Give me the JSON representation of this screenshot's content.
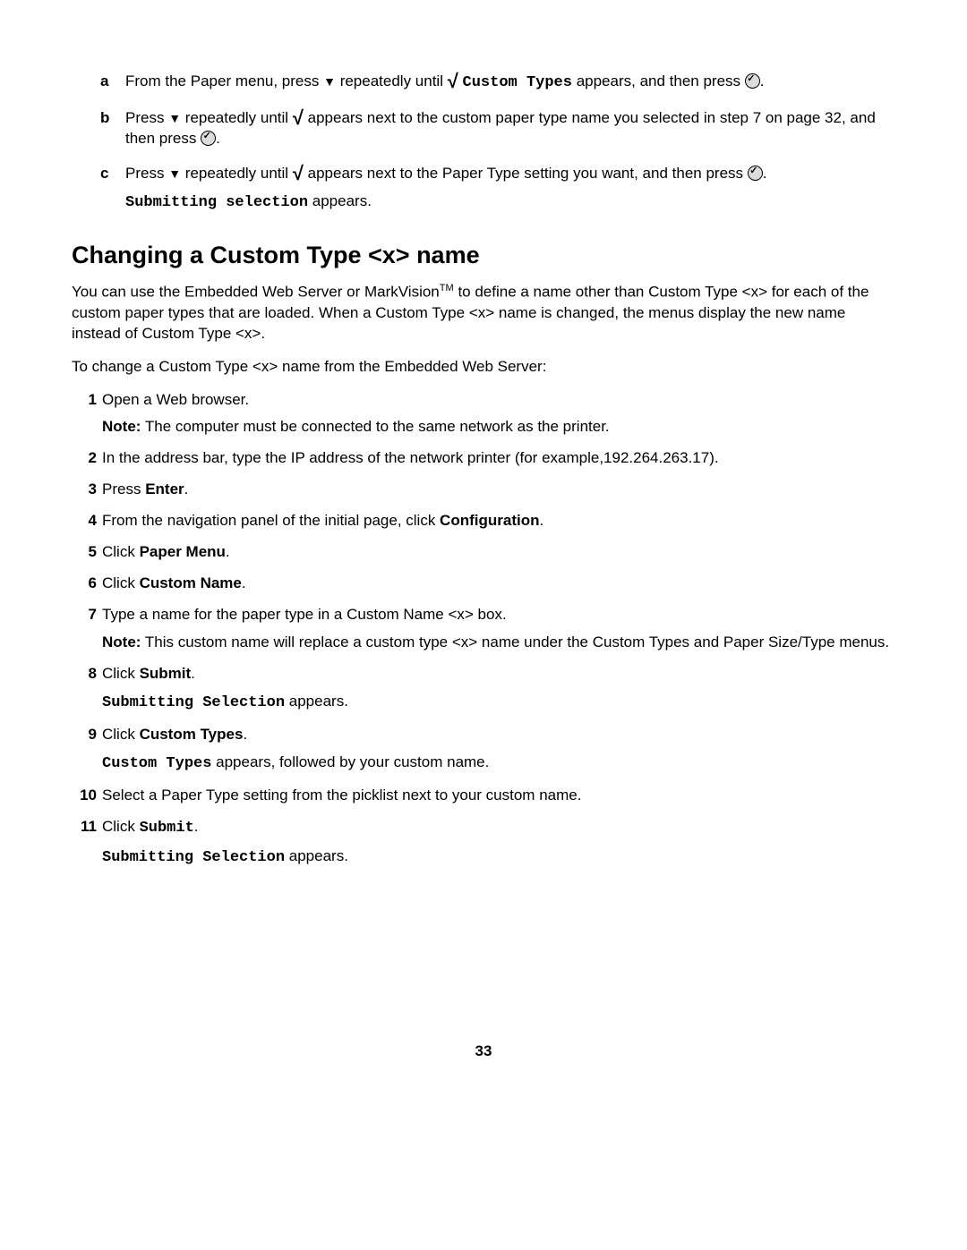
{
  "steps_lettered": {
    "a": {
      "marker": "a",
      "pre": "From the Paper menu, press ",
      "mid": " repeatedly until ",
      "mono": "Custom Types",
      "post": " appears, and then press ",
      "end": "."
    },
    "b": {
      "marker": "b",
      "pre": "Press ",
      "mid": " repeatedly until ",
      "post": " appears next to the custom paper type name you selected in step 7 on page 32, and then press ",
      "end": "."
    },
    "c": {
      "marker": "c",
      "pre": "Press ",
      "mid": " repeatedly until ",
      "post": " appears next to the Paper Type setting you want, and then press ",
      "end": ".",
      "line2_mono": "Submitting selection",
      "line2_rest": " appears."
    }
  },
  "heading": "Changing a Custom Type <x> name",
  "intro1_a": "You can use the Embedded Web Server or MarkVision",
  "intro1_tm": "TM",
  "intro1_b": " to define a name other than Custom Type <x> for each of the custom paper types that are loaded. When a Custom Type <x> name is changed, the menus display the new name instead of Custom Type <x>.",
  "intro2": "To change a Custom Type <x> name from the Embedded Web Server:",
  "num": {
    "1": {
      "n": "1",
      "t": "Open a Web browser.",
      "note_label": "Note:",
      "note_rest": " The computer must be connected to the same network as the printer."
    },
    "2": {
      "n": "2",
      "t": "In the address bar, type the IP address of the network printer (for example,192.264.263.17)."
    },
    "3": {
      "n": "3",
      "pre": "Press ",
      "bold": "Enter",
      "post": "."
    },
    "4": {
      "n": "4",
      "pre": "From the navigation panel of the initial page, click ",
      "bold": "Configuration",
      "post": "."
    },
    "5": {
      "n": "5",
      "pre": "Click ",
      "bold": "Paper Menu",
      "post": "."
    },
    "6": {
      "n": "6",
      "pre": "Click ",
      "bold": "Custom Name",
      "post": "."
    },
    "7": {
      "n": "7",
      "t": "Type a name for the paper type in a Custom Name <x> box.",
      "note_label": "Note:",
      "note_rest": " This custom name will replace a custom type <x> name under the Custom Types and Paper Size/Type menus."
    },
    "8": {
      "n": "8",
      "pre": "Click ",
      "bold": "Submit",
      "post": ".",
      "sub_mono": "Submitting Selection",
      "sub_rest": " appears."
    },
    "9": {
      "n": "9",
      "pre": "Click ",
      "bold": "Custom Types",
      "post": ".",
      "sub_mono": "Custom Types",
      "sub_rest": " appears, followed by your custom name."
    },
    "10": {
      "n": "10",
      "t": "Select a Paper Type setting from the picklist next to your custom name."
    },
    "11": {
      "n": "11",
      "pre": "Click ",
      "mono": "Submit",
      "post": ".",
      "sub_mono": "Submitting Selection",
      "sub_rest": " appears."
    }
  },
  "page_number": "33"
}
